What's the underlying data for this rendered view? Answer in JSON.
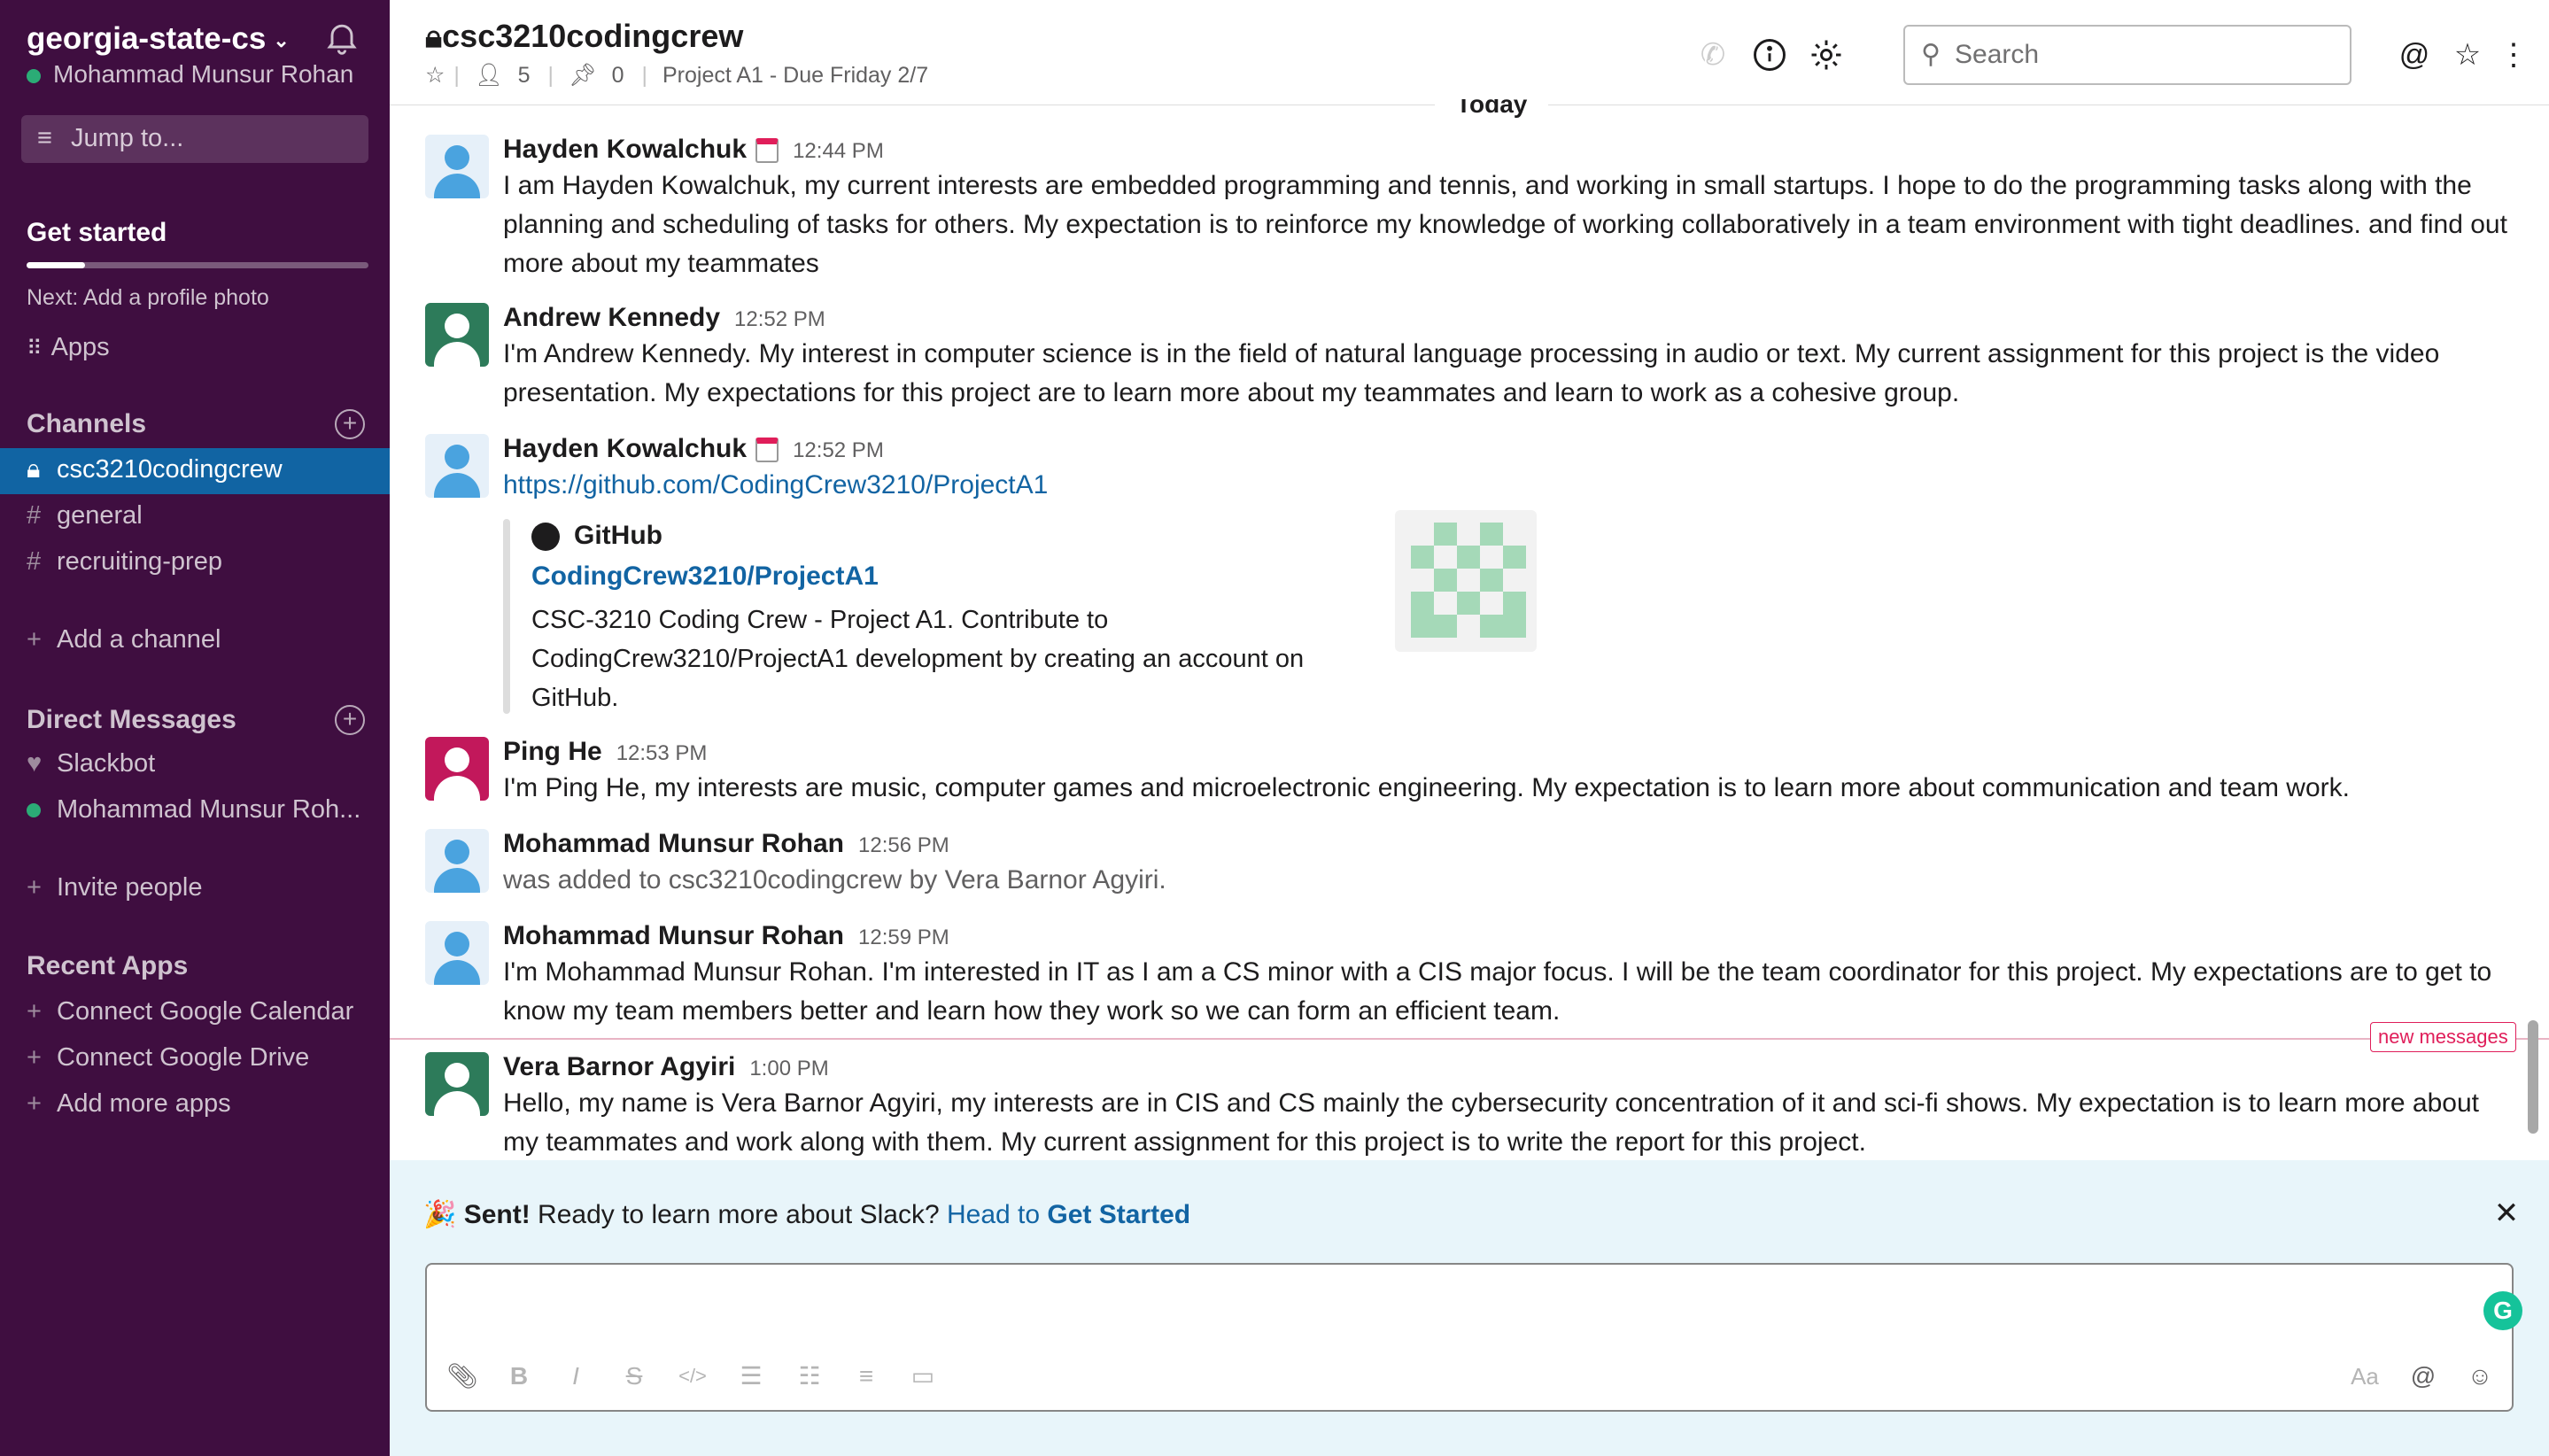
{
  "workspace": {
    "name": "georgia-state-cs",
    "user": "Mohammad Munsur Rohan",
    "jump_to": "Jump to..."
  },
  "get_started": {
    "title": "Get started",
    "next": "Next: Add a profile photo",
    "progress": 0.17
  },
  "apps_label": "Apps",
  "channels": {
    "title": "Channels",
    "items": [
      {
        "name": "csc3210codingcrew",
        "private": true,
        "active": true
      },
      {
        "name": "general",
        "private": false,
        "active": false
      },
      {
        "name": "recruiting-prep",
        "private": false,
        "active": false
      }
    ],
    "add_label": "Add a channel"
  },
  "direct_messages": {
    "title": "Direct Messages",
    "items": [
      "Slackbot",
      "Mohammad Munsur Roh..."
    ]
  },
  "invite_label": "Invite people",
  "recent_apps": {
    "title": "Recent Apps",
    "items": [
      "Connect Google Calendar",
      "Connect Google Drive",
      "Add more apps"
    ]
  },
  "header": {
    "channel": "csc3210codingcrew",
    "members": "5",
    "pins": "0",
    "topic": "Project A1 - Due Friday 2/7",
    "search_placeholder": "Search"
  },
  "day_divider": "Today",
  "messages": [
    {
      "sender": "Hayden Kowalchuk",
      "time": "12:44 PM",
      "text": "I am Hayden Kowalchuk, my current interests are embedded programming and tennis, and working in small startups. I hope to do the programming tasks along with the planning and scheduling of tasks for others. My expectation is to reinforce my knowledge of working collaboratively in a team environment with tight deadlines. and find out more about my teammates"
    },
    {
      "sender": "Andrew Kennedy",
      "time": "12:52 PM",
      "text": "I'm Andrew Kennedy. My interest in computer science is in the field of natural language processing in audio or text. My current assignment for this project is the video presentation. My expectations for this project are to learn more about my teammates and learn to work as a cohesive group."
    },
    {
      "sender": "Hayden Kowalchuk",
      "time": "12:52 PM",
      "text": "https://github.com/CodingCrew3210/ProjectA1"
    },
    {
      "sender": "Ping He",
      "time": "12:53 PM",
      "text": "I'm Ping He, my interests are music, computer games and  microelectronic engineering. My expectation is to learn more about communication and team work."
    },
    {
      "sender": "Mohammad Munsur Rohan",
      "time": "12:56 PM",
      "text": "was added to csc3210codingcrew by Vera Barnor Agyiri."
    },
    {
      "sender": "Mohammad Munsur Rohan",
      "time": "12:59 PM",
      "text": "I'm Mohammad Munsur Rohan. I'm interested in IT as I am a CS minor with a CIS major focus. I will be the team coordinator for this project. My expectations are to get to know my team members better and learn how they work so we can form an efficient team."
    },
    {
      "sender": "Vera Barnor Agyiri",
      "time": "1:00 PM",
      "text": "Hello, my name is Vera Barnor Agyiri, my interests are in CIS and CS mainly the cybersecurity concentration of it and sci-fi shows. My expectation is to learn more about my teammates and work along with them. My current assignment for this project is to write the report for this project."
    }
  ],
  "attachment": {
    "site": "GitHub",
    "title": "CodingCrew3210/ProjectA1",
    "description": "CSC-3210 Coding Crew - Project A1. Contribute to CodingCrew3210/ProjectA1 development by creating an account on GitHub."
  },
  "new_messages_label": "new messages",
  "banner": {
    "emoji": "🎉",
    "sent": "Sent!",
    "text": "Ready to learn more about Slack?",
    "head_to": "Head to",
    "link": "Get Started"
  },
  "colors": {
    "sidebar": "#3f0e40",
    "active": "#1164a3",
    "link": "#1264a3",
    "avatar_green": "#2d7b5a",
    "avatar_red": "#c2185b",
    "avatar_blue": "#4a90c8"
  }
}
